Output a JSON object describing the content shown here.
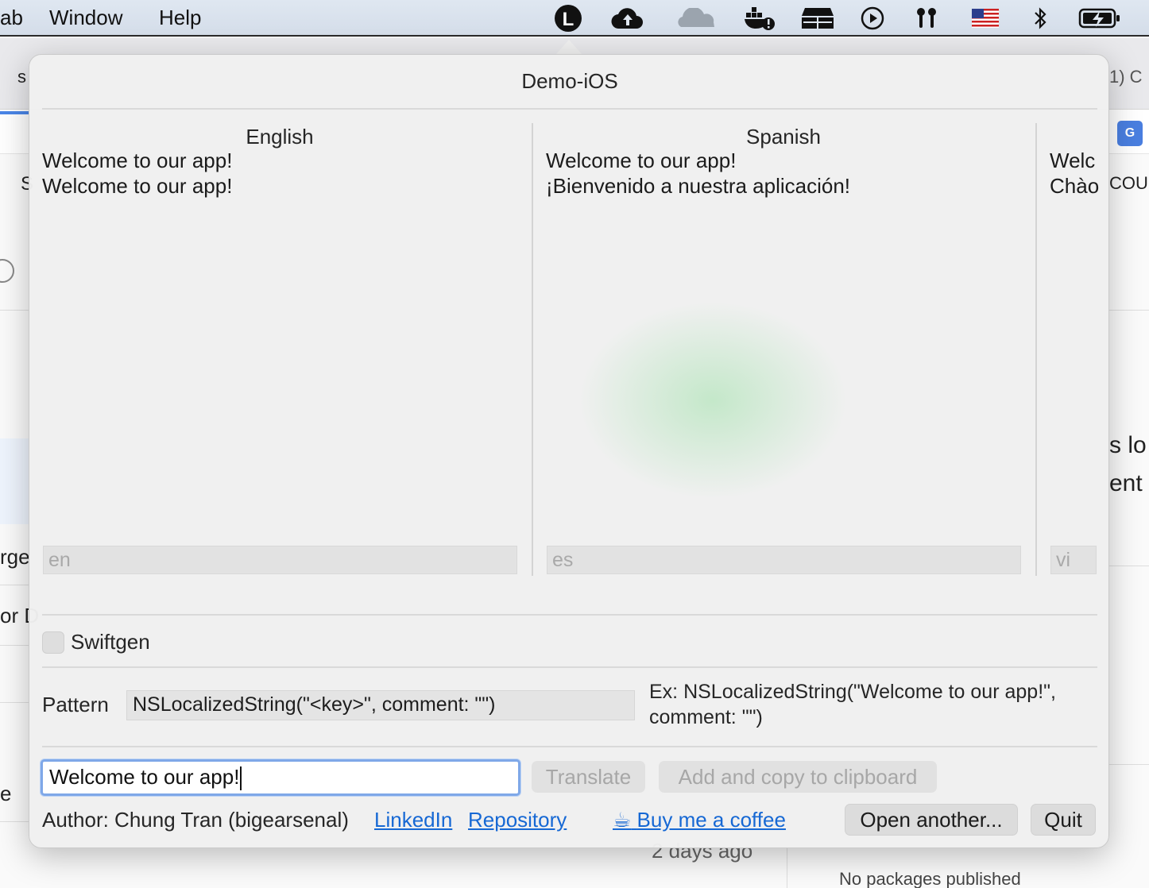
{
  "menubar": {
    "items": [
      "ab",
      "Window",
      "Help"
    ],
    "status_icons": [
      "l-app-icon",
      "cloud-upload-icon",
      "cloudflare-icon",
      "docker-icon",
      "storage-icon",
      "play-icon",
      "airpods-icon",
      "us-flag-icon",
      "bluetooth-icon",
      "battery-charging-icon"
    ]
  },
  "background": {
    "tab_text_left": "s",
    "tab_text_right": "1) C",
    "side_text_1": "S",
    "side_text_2": "rge",
    "side_text_3": "or D",
    "side_text_4": "e",
    "right_text_1": "COUR",
    "right_text_2": "s lo",
    "right_text_3": "ent",
    "date_text": "2 days ago",
    "packages_text": "No packages published"
  },
  "popover": {
    "project_title": "Demo-iOS",
    "languages": [
      {
        "name": "English",
        "lines": [
          "Welcome to our app!",
          "Welcome to our app!"
        ],
        "code": "en"
      },
      {
        "name": "Spanish",
        "lines": [
          "Welcome to our app!",
          "¡Bienvenido a nuestra aplicación!"
        ],
        "code": "es"
      },
      {
        "name": "",
        "lines": [
          "Welc",
          "Chào"
        ],
        "code": "vi"
      }
    ],
    "swiftgen_label": "Swiftgen",
    "pattern_label": "Pattern",
    "pattern_value": "NSLocalizedString(\"<key>\", comment: \"\")",
    "example_text": "Ex: NSLocalizedString(\"Welcome to our app!\", comment: \"\")",
    "input_value": "Welcome to our app!",
    "translate_button": "Translate",
    "add_copy_button": "Add and copy to clipboard",
    "author_text": "Author: Chung Tran (bigearsenal)",
    "linkedin_link": "LinkedIn",
    "repository_link": "Repository",
    "coffee_link": "Buy me a coffee",
    "open_another_button": "Open another...",
    "quit_button": "Quit"
  },
  "colors": {
    "link": "#1668d4",
    "focus_ring": "#7fa8e8"
  }
}
